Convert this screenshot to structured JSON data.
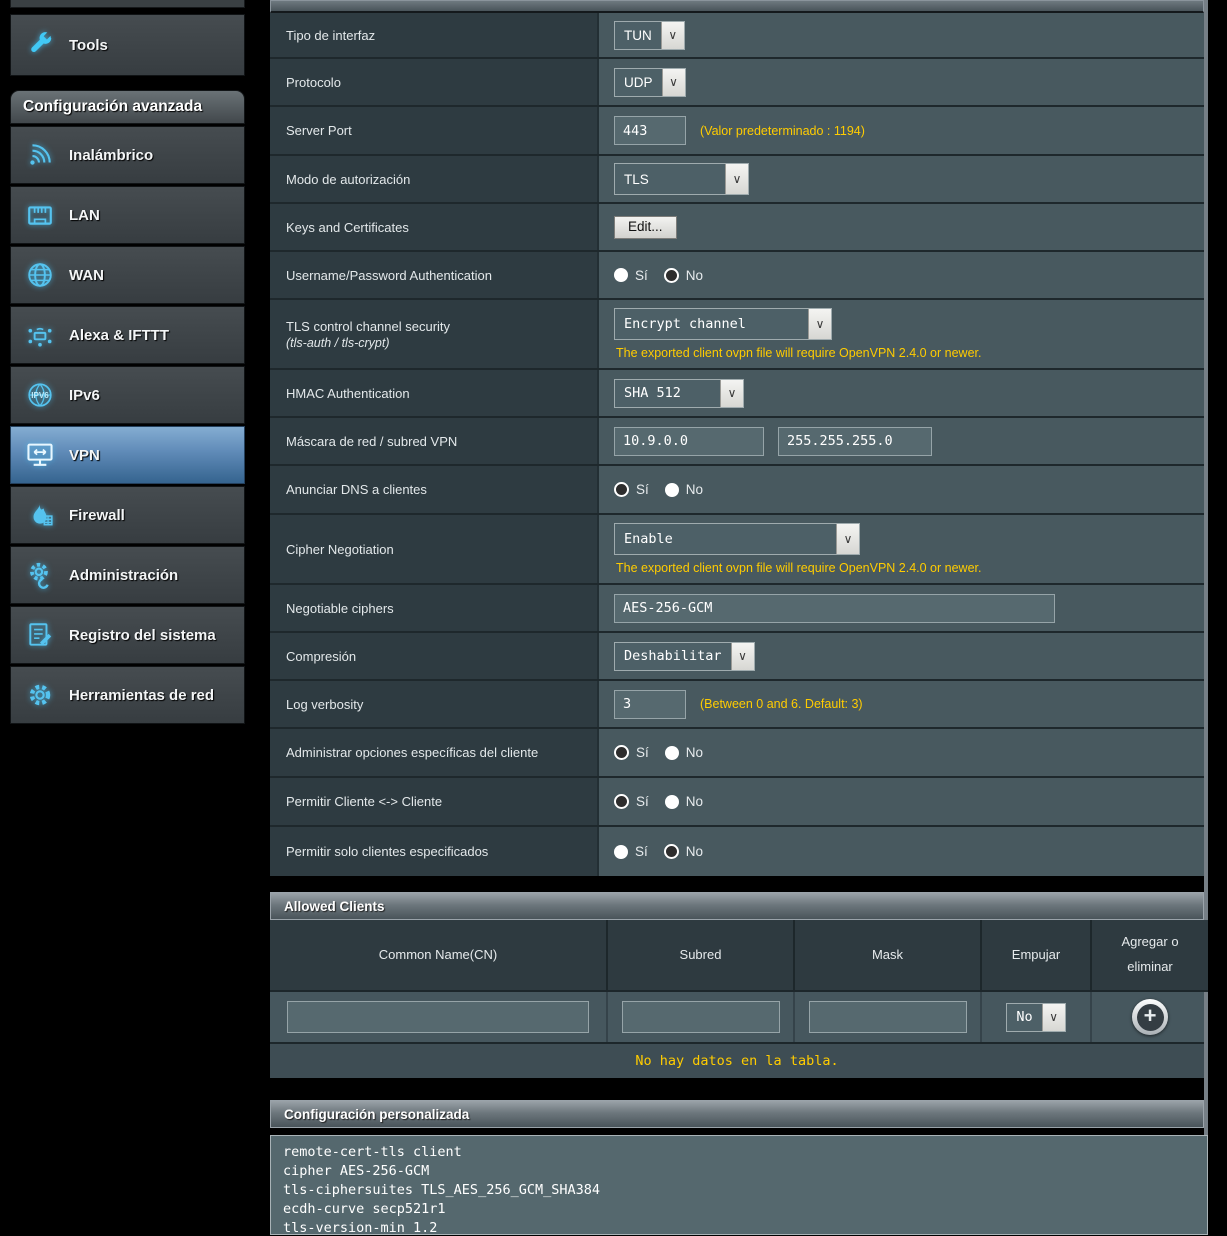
{
  "colors": {
    "accent_yellow": "#ffcc00",
    "sidebar_icon_blue": "#55c3ef",
    "active_item_blue": "#5f8ab7",
    "label_cell_bg": "#2e3b41",
    "value_cell_bg": "#48595f"
  },
  "labels": {
    "yes": "Sí",
    "no": "No"
  },
  "sidebar": {
    "tools": {
      "label": "Tools",
      "icon": "wrench-icon"
    },
    "section_header": "Configuración avanzada",
    "items": [
      {
        "label": "Inalámbrico",
        "icon": "wireless-icon"
      },
      {
        "label": "LAN",
        "icon": "lan-icon"
      },
      {
        "label": "WAN",
        "icon": "wan-icon"
      },
      {
        "label": "Alexa & IFTTT",
        "icon": "alexa-ifttt-icon"
      },
      {
        "label": "IPv6",
        "icon": "ipv6-icon"
      },
      {
        "label": "VPN",
        "icon": "vpn-icon",
        "active": true
      },
      {
        "label": "Firewall",
        "icon": "firewall-icon"
      },
      {
        "label": "Administración",
        "icon": "admin-gear-icon"
      },
      {
        "label": "Registro del sistema",
        "icon": "system-log-icon"
      },
      {
        "label": "Herramientas de red",
        "icon": "network-tools-icon"
      }
    ]
  },
  "form": {
    "tipo": {
      "label": "Tipo de interfaz",
      "value": "TUN"
    },
    "protocolo": {
      "label": "Protocolo",
      "value": "UDP"
    },
    "server_port": {
      "label": "Server Port",
      "value": "443",
      "note": "(Valor predeterminado : 1194)"
    },
    "modo_auth": {
      "label": "Modo de autorización",
      "value": "TLS"
    },
    "keys_certs": {
      "label": "Keys and Certificates",
      "button": "Edit..."
    },
    "user_pass": {
      "label": "Username/Password Authentication",
      "selected": "No"
    },
    "tls_control": {
      "label": "TLS control channel security",
      "sublabel": "(tls-auth / tls-crypt)",
      "value": "Encrypt channel",
      "note": "The exported client ovpn file will require OpenVPN 2.4.0 or newer."
    },
    "hmac": {
      "label": "HMAC Authentication",
      "value": "SHA 512"
    },
    "mascara": {
      "label": "Máscara de red / subred VPN",
      "value1": "10.9.0.0",
      "value2": "255.255.255.0"
    },
    "anunciar_dns": {
      "label": "Anunciar DNS a clientes",
      "selected": "Sí"
    },
    "cipher_neg": {
      "label": "Cipher Negotiation",
      "value": "Enable",
      "note": "The exported client ovpn file will require OpenVPN 2.4.0 or newer."
    },
    "negotiable": {
      "label": "Negotiable ciphers",
      "value": "AES-256-GCM"
    },
    "compresion": {
      "label": "Compresión",
      "value": "Deshabilitar"
    },
    "log_verbosity": {
      "label": "Log verbosity",
      "value": "3",
      "note": "(Between 0 and 6. Default: 3)"
    },
    "admin_opts": {
      "label": "Administrar opciones específicas del cliente",
      "selected": "Sí"
    },
    "client_to_client": {
      "label": "Permitir Cliente <-> Cliente",
      "selected": "Sí"
    },
    "only_specified": {
      "label": "Permitir solo clientes especificados",
      "selected": "No"
    }
  },
  "allowed_clients": {
    "title": "Allowed Clients",
    "columns": [
      "Common Name(CN)",
      "Subred",
      "Mask",
      "Empujar",
      "Agregar o eliminar"
    ],
    "push_value": "No",
    "empty_message": "No hay datos en la tabla."
  },
  "custom_config": {
    "title": "Configuración personalizada",
    "content": "remote-cert-tls client\ncipher AES-256-GCM\ntls-ciphersuites TLS_AES_256_GCM_SHA384\necdh-curve secp521r1\ntls-version-min 1.2"
  }
}
